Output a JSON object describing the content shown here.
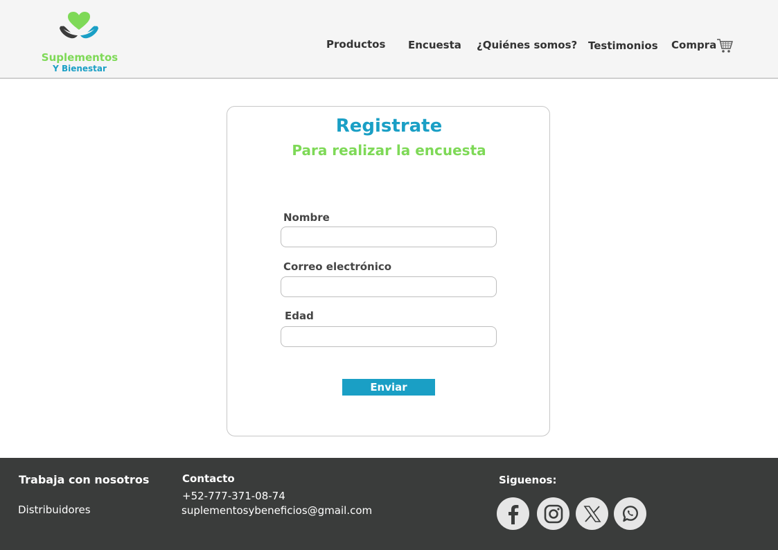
{
  "brand": {
    "line1": "Suplementos",
    "line2": "Y Bienestar"
  },
  "nav": {
    "items": [
      {
        "label": "Productos"
      },
      {
        "label": "Encuesta"
      },
      {
        "label": "¿Quiénes somos?"
      },
      {
        "label": "Testimonios"
      },
      {
        "label": "Compra"
      }
    ],
    "cart_icon": "shopping-cart-icon"
  },
  "form": {
    "title": "Registrate",
    "subtitle": "Para realizar la encuesta",
    "fields": [
      {
        "label": "Nombre",
        "value": "",
        "placeholder": ""
      },
      {
        "label": "Correo electrónico",
        "value": "",
        "placeholder": ""
      },
      {
        "label": "Edad",
        "value": "",
        "placeholder": ""
      }
    ],
    "submit_label": "Enviar"
  },
  "footer": {
    "work_title": "Trabaja con nosotros",
    "work_link": "Distribuidores",
    "contact_title": "Contacto",
    "phone": "+52-777-371-08-74",
    "email": "suplementosybeneficios@gmail.com",
    "social_title": "Siguenos:",
    "social": [
      {
        "name": "facebook-icon"
      },
      {
        "name": "instagram-icon"
      },
      {
        "name": "x-icon"
      },
      {
        "name": "whatsapp-icon"
      }
    ]
  },
  "colors": {
    "primary_blue": "#1a9fc5",
    "accent_green": "#7ed957",
    "footer_bg": "#3a3c3b",
    "header_bg": "#f5f5f5"
  }
}
